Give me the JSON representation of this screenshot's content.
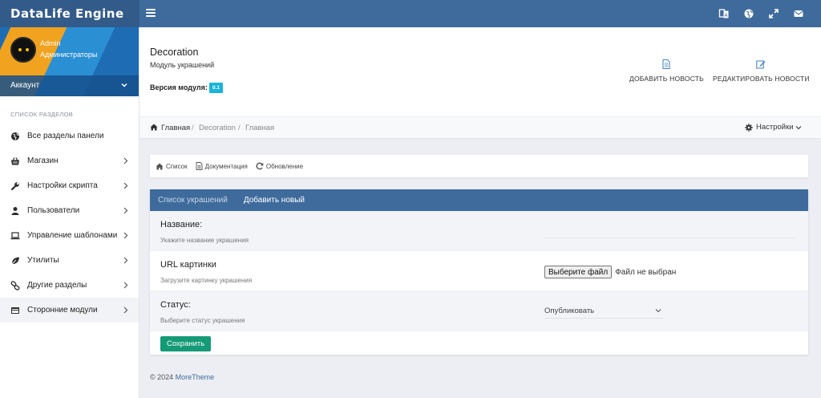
{
  "app": {
    "brand": "DataLife Engine"
  },
  "profile": {
    "name": "Admin",
    "role": "Администраторы",
    "account_label": "Аккаунт"
  },
  "sidebar": {
    "section_title": "СПИСОК РАЗДЕЛОВ",
    "items": [
      {
        "label": "Все разделы панели",
        "icon": "globe-icon",
        "has_children": false
      },
      {
        "label": "Магазин",
        "icon": "basket-icon",
        "has_children": true
      },
      {
        "label": "Настройки скрипта",
        "icon": "wrench-icon",
        "has_children": true
      },
      {
        "label": "Пользователи",
        "icon": "user-icon",
        "has_children": true
      },
      {
        "label": "Управление шаблонами",
        "icon": "laptop-icon",
        "has_children": true
      },
      {
        "label": "Утилиты",
        "icon": "leaf-icon",
        "has_children": true
      },
      {
        "label": "Другие разделы",
        "icon": "link-icon",
        "has_children": true
      },
      {
        "label": "Сторонние модули",
        "icon": "window-icon",
        "has_children": true,
        "active": true
      }
    ]
  },
  "header": {
    "title": "Decoration",
    "subtitle": "Модуль украшений",
    "version_label": "Версия модуля:",
    "version": "0.1",
    "actions": [
      {
        "label": "ДОБАВИТЬ НОВОСТЬ",
        "icon": "file-text-icon"
      },
      {
        "label": "РЕДАКТИРОВАТЬ НОВОСТИ",
        "icon": "edit-icon"
      }
    ]
  },
  "breadcrumb": {
    "items": [
      "Главная",
      "Decoration",
      "Главная"
    ],
    "settings_label": "Настройки"
  },
  "toolbar": {
    "items": [
      "Список",
      "Документация",
      "Обновление"
    ]
  },
  "form": {
    "tabs": [
      {
        "label": "Список украшений",
        "active": false
      },
      {
        "label": "Добавить новый",
        "active": true
      }
    ],
    "fields": {
      "name": {
        "label": "Название:",
        "hint": "Укажите название украшения",
        "value": "",
        "placeholder": ""
      },
      "image": {
        "label": "URL картинки",
        "hint": "Загрузите картинку украшения",
        "button_label": "Выберите файл",
        "no_file_text": "Файл не выбран"
      },
      "status": {
        "label": "Статус:",
        "hint": "Выберите статус украшения",
        "value": "Опубликовать"
      }
    },
    "submit_label": "Сохранить"
  },
  "footer": {
    "copyright": "© 2024",
    "brand": "MoreTheme"
  },
  "colors": {
    "topbar": "#3f6b9c",
    "brand_bg": "#335b89",
    "accent": "#1bb5d8",
    "save": "#159a77"
  }
}
